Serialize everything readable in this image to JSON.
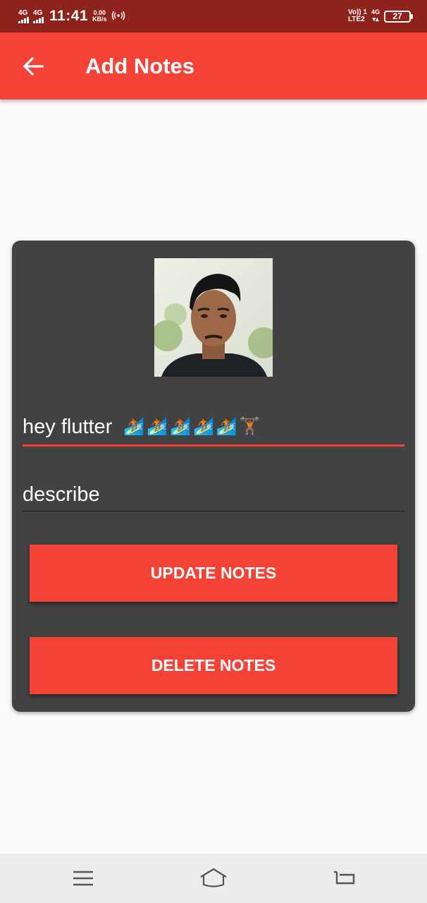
{
  "status_bar": {
    "sim1_label": "4G",
    "sim2_label": "4G",
    "time": "11:41",
    "speed_value": "0.00",
    "speed_unit": "KB/s",
    "hotspot_icon": "hotspot-icon",
    "volte_top": "Vo)) 1",
    "volte_bottom": "LTE2",
    "network_top": "4G",
    "network_bottom": "▾▴",
    "battery_level": "27"
  },
  "app_bar": {
    "title": "Add Notes",
    "back_icon": "arrow-left-icon",
    "background": "#f44336"
  },
  "note": {
    "avatar_icon": "profile-photo",
    "title_value": "hey flutter",
    "title_emojis": [
      "🏄🏾",
      "🏄🏾",
      "🏄🏾",
      "🏄🏾",
      "🏄🏾",
      "🏋🏾"
    ],
    "description_value": "describe",
    "update_label": "UPDATE NOTES",
    "delete_label": "DELETE NOTES"
  },
  "nav_bar": {
    "menu_icon": "menu-icon",
    "home_icon": "home-icon",
    "back_icon": "back-icon"
  },
  "colors": {
    "status_bar": "#8e221c",
    "primary": "#f44336",
    "card": "#424242",
    "background": "#fafafa"
  }
}
